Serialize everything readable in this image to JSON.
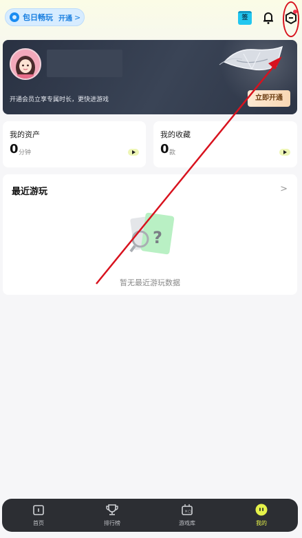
{
  "topbar": {
    "pill_title": "包日畅玩",
    "pill_action": "开通",
    "pill_chevron": ">",
    "sign_label": "签"
  },
  "banner": {
    "promo_text": "开通会员立享专属时长，更快进游戏",
    "open_button": "立即开通"
  },
  "assets": {
    "label": "我的资产",
    "value": "0",
    "unit": "分钟"
  },
  "favorites": {
    "label": "我的收藏",
    "value": "0",
    "unit": "款"
  },
  "recent": {
    "title": "最近游玩",
    "chevron": ">",
    "empty_text": "暂无最近游玩数据"
  },
  "nav": {
    "items": [
      {
        "label": "首页"
      },
      {
        "label": "排行榜"
      },
      {
        "label": "游戏库"
      },
      {
        "label": "我的",
        "active": true
      }
    ]
  },
  "colors": {
    "accent_blue": "#1a8cf2",
    "nav_active": "#e5f24a",
    "annotation_red": "#d8121e",
    "banner_dark": "#2e3647"
  }
}
